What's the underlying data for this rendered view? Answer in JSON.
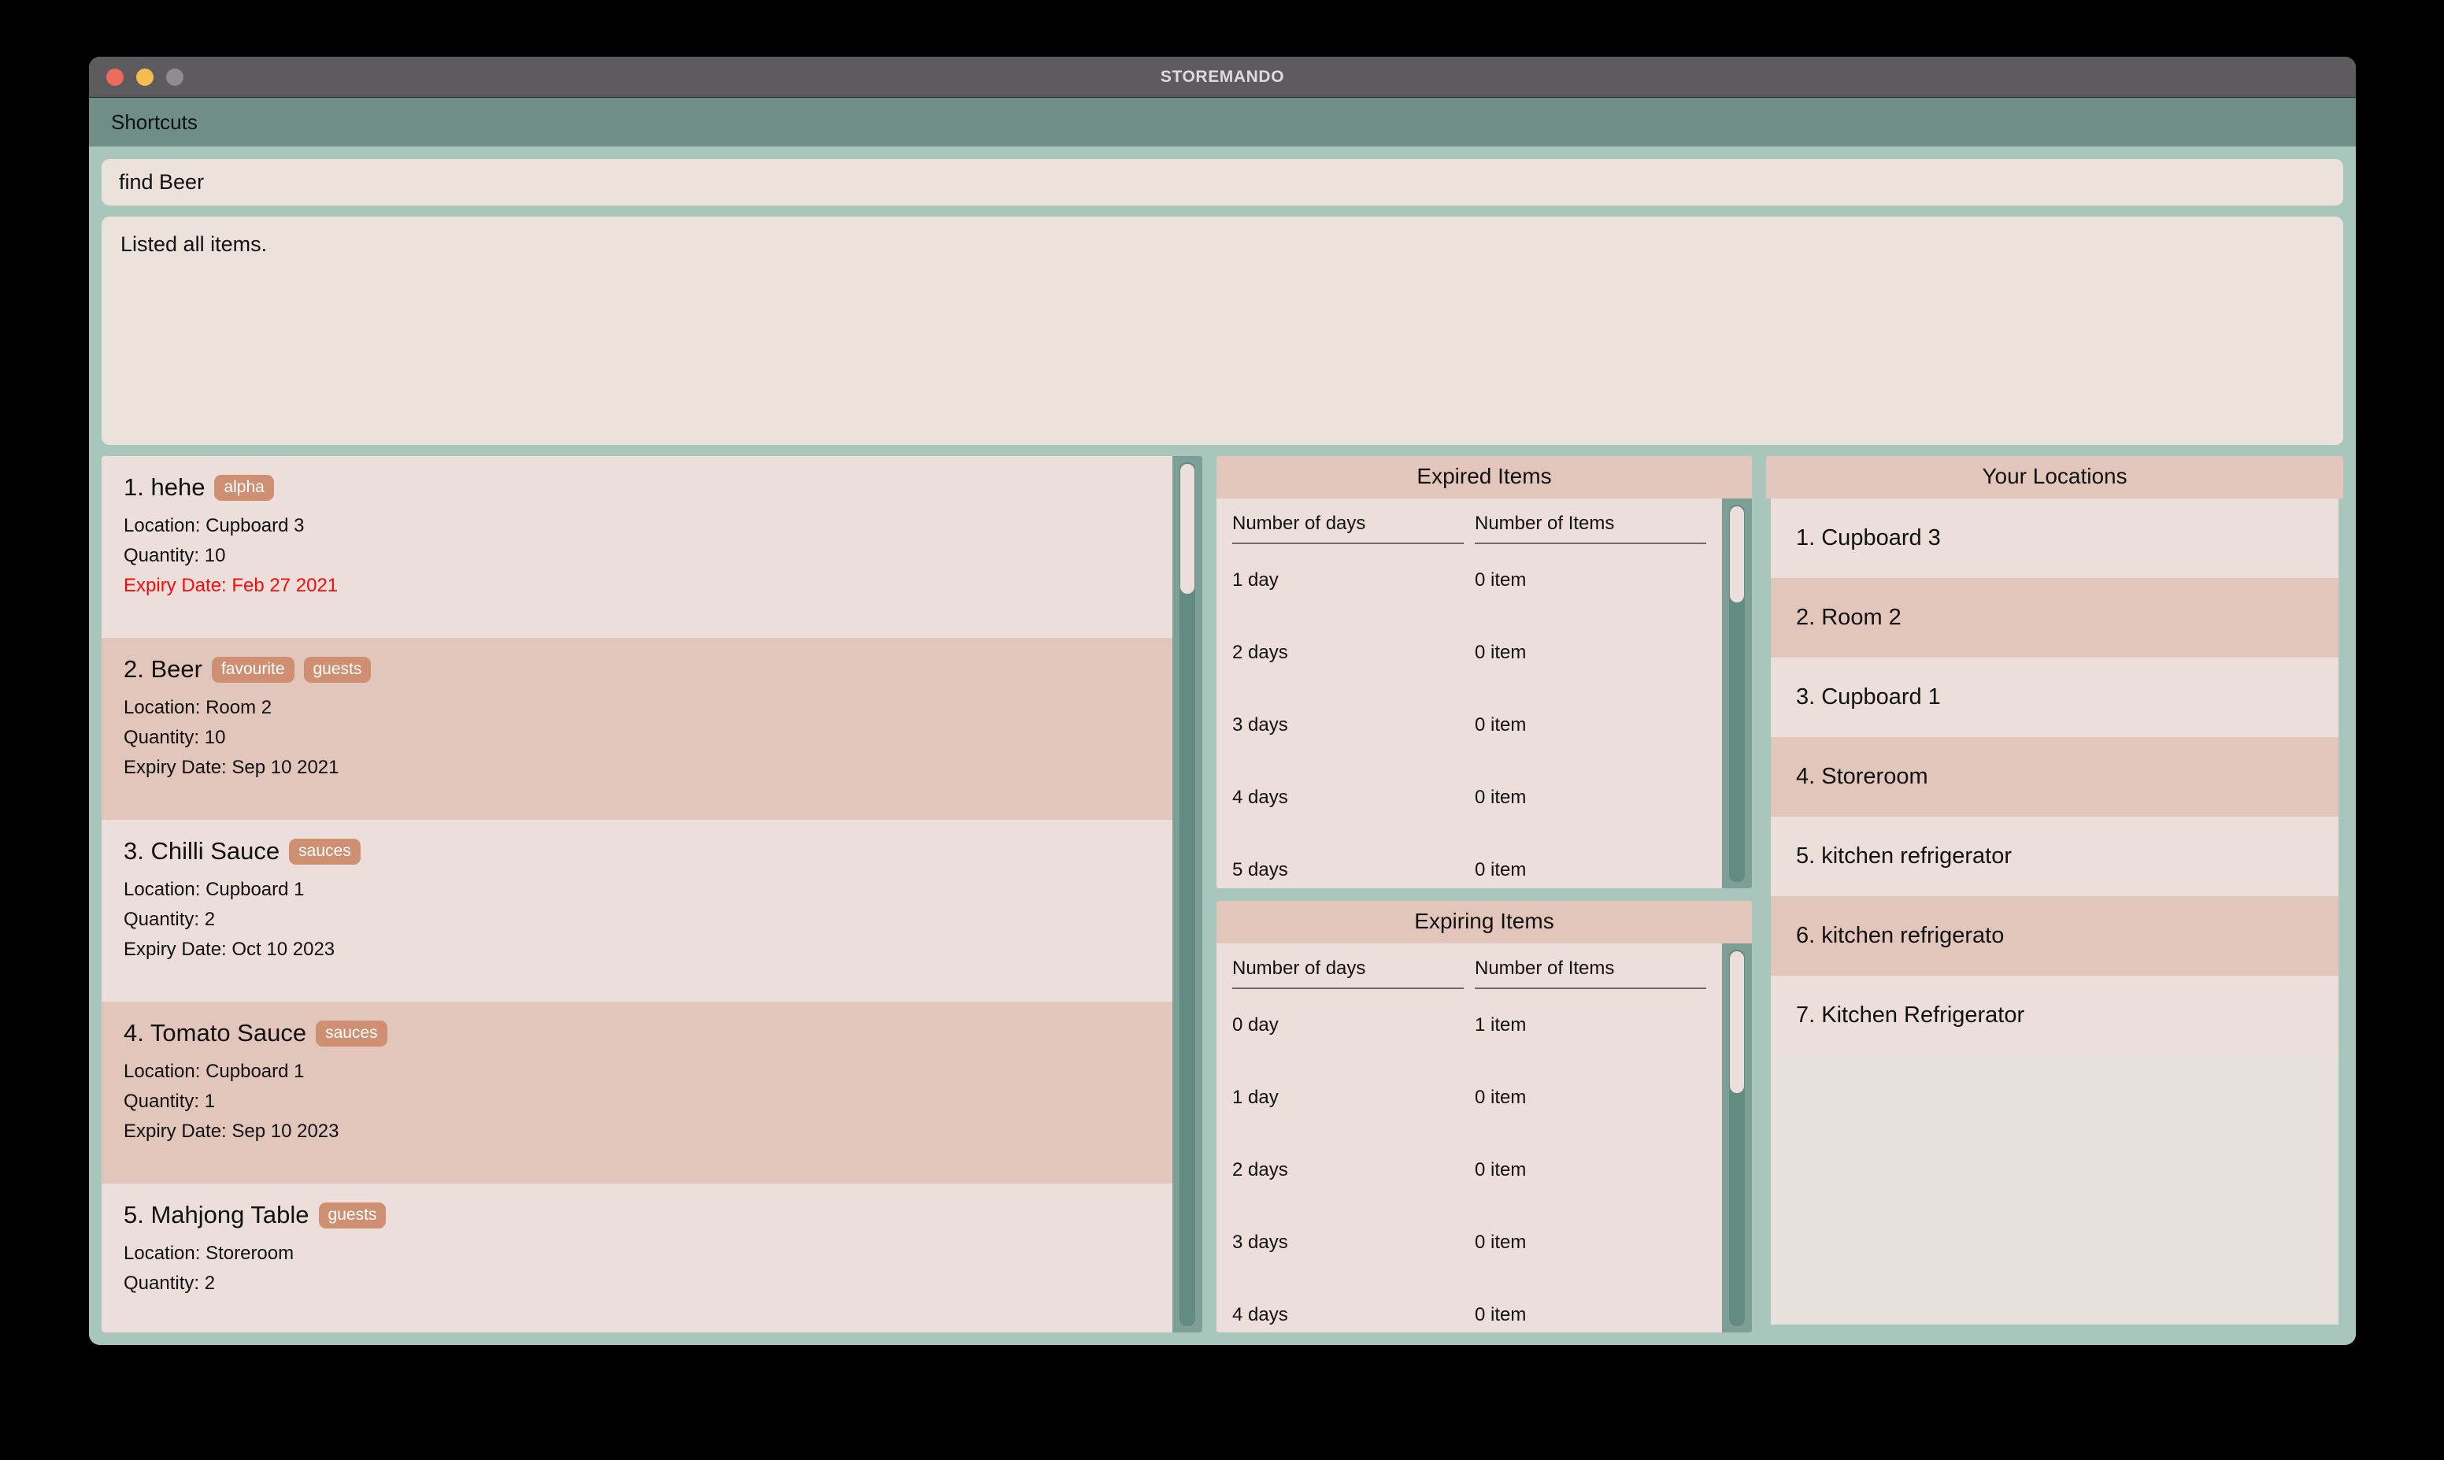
{
  "window": {
    "title": "STOREMANDO",
    "traffic_lights": [
      {
        "name": "close",
        "color": "#ed6a5e"
      },
      {
        "name": "minimize",
        "color": "#f5bd4f"
      },
      {
        "name": "zoom",
        "color": "#8d8d8d"
      }
    ]
  },
  "menu": {
    "items": [
      {
        "label": "Shortcuts"
      }
    ]
  },
  "command": {
    "value": "find Beer",
    "placeholder": "Enter command here..."
  },
  "result": {
    "text": "Listed all items."
  },
  "item_list": {
    "items": [
      {
        "index": "1.",
        "name": "hehe",
        "tags": [
          "alpha"
        ],
        "location": "Location: Cupboard 3",
        "quantity": "Quantity: 10",
        "expiry": "Expiry Date: Feb 27 2021",
        "expired": true
      },
      {
        "index": "2.",
        "name": "Beer",
        "tags": [
          "favourite",
          "guests"
        ],
        "location": "Location: Room 2",
        "quantity": "Quantity: 10",
        "expiry": "Expiry Date: Sep 10 2021",
        "expired": false
      },
      {
        "index": "3.",
        "name": "Chilli Sauce",
        "tags": [
          "sauces"
        ],
        "location": "Location: Cupboard 1",
        "quantity": "Quantity: 2",
        "expiry": "Expiry Date: Oct 10 2023",
        "expired": false
      },
      {
        "index": "4.",
        "name": "Tomato Sauce",
        "tags": [
          "sauces"
        ],
        "location": "Location: Cupboard 1",
        "quantity": "Quantity: 1",
        "expiry": "Expiry Date: Sep 10 2023",
        "expired": false
      },
      {
        "index": "5.",
        "name": "Mahjong Table",
        "tags": [
          "guests"
        ],
        "location": "Location: Storeroom",
        "quantity": "Quantity: 2",
        "expiry": "",
        "expired": false
      }
    ]
  },
  "expired_items": {
    "title": "Expired Items",
    "columns": [
      "Number of days",
      "Number of Items"
    ],
    "rows": [
      [
        "1 day",
        "0 item"
      ],
      [
        "2 days",
        "0 item"
      ],
      [
        "3 days",
        "0 item"
      ],
      [
        "4 days",
        "0 item"
      ],
      [
        "5 days",
        "0 item"
      ]
    ]
  },
  "expiring_items": {
    "title": "Expiring Items",
    "columns": [
      "Number of days",
      "Number of Items"
    ],
    "rows": [
      [
        "0 day",
        "1 item"
      ],
      [
        "1 day",
        "0 item"
      ],
      [
        "2 days",
        "0 item"
      ],
      [
        "3 days",
        "0 item"
      ],
      [
        "4 days",
        "0 item"
      ]
    ]
  },
  "locations": {
    "title": "Your Locations",
    "rows": [
      "1. Cupboard 3",
      "2. Room 2",
      "3. Cupboard 1",
      "4. Storeroom",
      "5. kitchen refrigerator",
      "6. kitchen refrigerato",
      "7. Kitchen Refrigerator"
    ]
  },
  "theme": {
    "window_bg": "#a9c6bd",
    "titlebar_bg": "#5e5b5e",
    "menubar_bg": "#6f8e86",
    "field_bg": "#ebe2dc",
    "row_light": "#ecdedb",
    "row_dark": "#e2c6bb",
    "tag_bg": "#cf8f73",
    "expired_text": "#f90b0b",
    "scroll_track": "#628b81"
  }
}
